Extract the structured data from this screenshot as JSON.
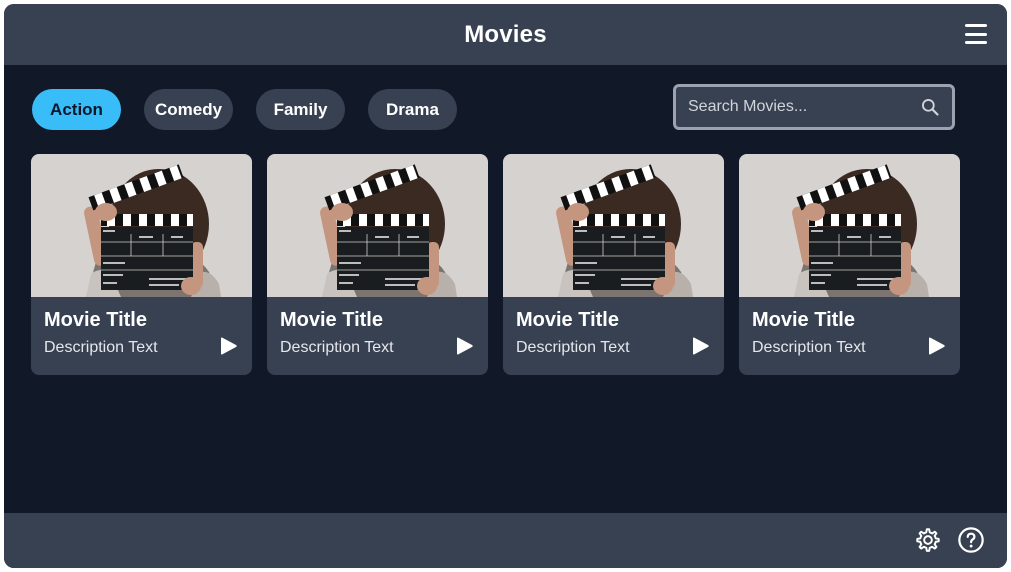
{
  "header": {
    "title": "Movies",
    "menu_icon": "hamburger-menu-icon"
  },
  "filters": [
    {
      "label": "Action",
      "active": true
    },
    {
      "label": "Comedy",
      "active": false
    },
    {
      "label": "Family",
      "active": false
    },
    {
      "label": "Drama",
      "active": false
    }
  ],
  "search": {
    "placeholder": "Search Movies...",
    "value": "",
    "icon": "search-icon"
  },
  "movies": [
    {
      "title": "Movie Title",
      "description": "Description Text",
      "image": "clapperboard-photo"
    },
    {
      "title": "Movie Title",
      "description": "Description Text",
      "image": "clapperboard-photo"
    },
    {
      "title": "Movie Title",
      "description": "Description Text",
      "image": "clapperboard-photo"
    },
    {
      "title": "Movie Title",
      "description": "Description Text",
      "image": "clapperboard-photo"
    }
  ],
  "footer": {
    "icons": [
      "gear-icon",
      "help-circle-icon"
    ]
  },
  "colors": {
    "background": "#111827",
    "surface": "#374151",
    "accent": "#38bdf8",
    "text": "#ffffff"
  }
}
